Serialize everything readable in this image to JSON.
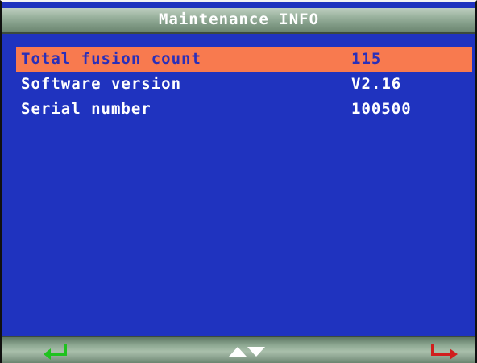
{
  "header": {
    "title": "Maintenance INFO"
  },
  "info_rows": [
    {
      "label": "Total fusion count",
      "value": "115",
      "selected": true
    },
    {
      "label": "Software version",
      "value": "V2.16",
      "selected": false
    },
    {
      "label": "Serial number",
      "value": "100500",
      "selected": false
    }
  ],
  "footer": {
    "icons": [
      "enter-arrow-icon",
      "up-down-arrows-icon",
      "exit-arrow-icon"
    ]
  },
  "colors": {
    "background": "#1f33bf",
    "selection": "#f87a4f",
    "enter_icon": "#1fc21f",
    "exit_icon": "#d11e1e"
  }
}
